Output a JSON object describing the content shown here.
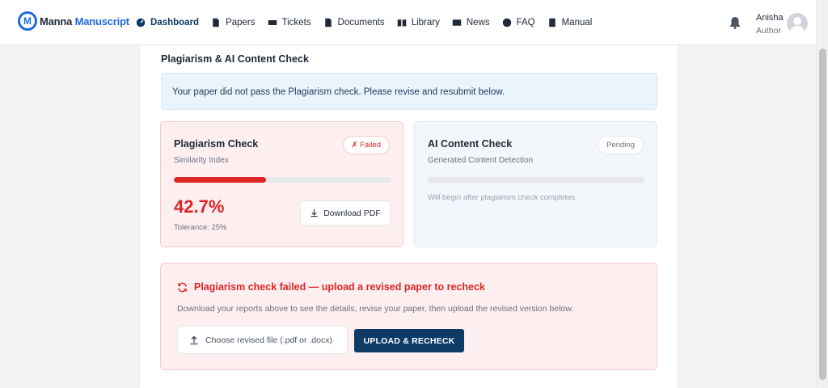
{
  "brand": {
    "name_part1": "Manna",
    "name_part2": "Manuscript",
    "logo_letter": "M"
  },
  "nav": [
    {
      "label": "Dashboard",
      "icon": "dashboard-icon",
      "active": true
    },
    {
      "label": "Papers",
      "icon": "file-icon"
    },
    {
      "label": "Tickets",
      "icon": "ticket-icon"
    },
    {
      "label": "Documents",
      "icon": "file-icon"
    },
    {
      "label": "Library",
      "icon": "book-icon"
    },
    {
      "label": "News",
      "icon": "newspaper-icon"
    },
    {
      "label": "FAQ",
      "icon": "question-icon"
    },
    {
      "label": "Manual",
      "icon": "manual-icon"
    }
  ],
  "user": {
    "name": "Anisha",
    "role": "Author"
  },
  "section": {
    "title": "Plagiarism & AI Content Check",
    "alert": "Your paper did not pass the Plagiarism check. Please revise and resubmit below."
  },
  "plagiarism": {
    "title": "Plagiarism Check",
    "subtitle": "Similarity Index",
    "status": "✗ Failed",
    "percent": "42.7%",
    "progress_fraction": 0.427,
    "tolerance": "Tolerance: 25%",
    "download_label": "Download PDF"
  },
  "ai_check": {
    "title": "AI Content Check",
    "subtitle": "Generated Content Detection",
    "status": "Pending",
    "note": "Will begin after plagiarism check completes."
  },
  "recheck": {
    "title": "Plagiarism check failed — upload a revised paper to recheck",
    "description": "Download your reports above to see the details, revise your paper, then upload the revised version below.",
    "file_placeholder": "Choose revised file (.pdf or .docx)",
    "upload_label": "UPLOAD & RECHECK"
  },
  "colors": {
    "primary": "#0d3b66",
    "danger": "#dc2626",
    "brand": "#1e6bd6"
  }
}
